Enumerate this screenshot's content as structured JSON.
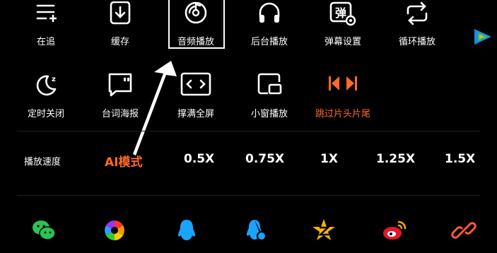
{
  "row1": [
    {
      "label": "在追",
      "icon": "add-list-icon"
    },
    {
      "label": "缓存",
      "icon": "download-icon"
    },
    {
      "label": "音频播放",
      "icon": "audio-disc-icon"
    },
    {
      "label": "后台播放",
      "icon": "headphones-icon"
    },
    {
      "label": "弹幕设置",
      "icon": "danmaku-settings-icon"
    },
    {
      "label": "循环播放",
      "icon": "loop-icon"
    }
  ],
  "row2": [
    {
      "label": "定时关闭",
      "icon": "moon-timer-icon"
    },
    {
      "label": "台词海报",
      "icon": "quote-poster-icon"
    },
    {
      "label": "撑满全屏",
      "icon": "fill-screen-icon"
    },
    {
      "label": "小窗播放",
      "icon": "mini-window-icon"
    },
    {
      "label": "跳过片头片尾",
      "icon": "skip-intro-outro-icon"
    }
  ],
  "speed": {
    "label": "播放速度",
    "options": [
      "AI模式",
      "0.5X",
      "0.75X",
      "1X",
      "1.25X",
      "1.5X"
    ],
    "selected": "AI模式"
  },
  "share": [
    "wechat-icon",
    "moments-icon",
    "qq-icon",
    "qq-contact-icon",
    "qzone-icon",
    "weibo-icon",
    "copy-link-icon"
  ],
  "colors": {
    "accent": "#ff6a2b",
    "background": "#000000",
    "text": "#ffffff",
    "wechat": "#2bc454",
    "qq": "#1aa3ff",
    "qzone": "#f6b400",
    "weibo": "#e6162d"
  }
}
